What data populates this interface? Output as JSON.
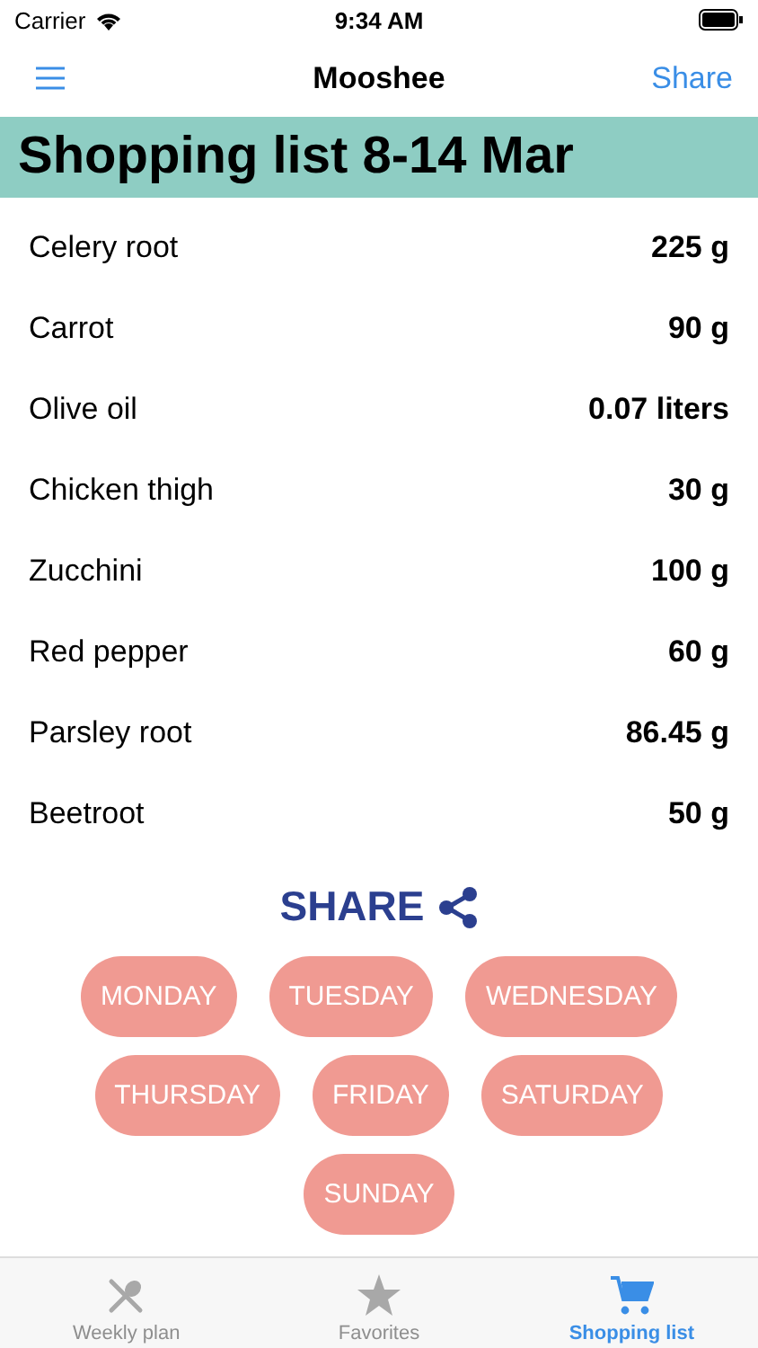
{
  "status_bar": {
    "carrier": "Carrier",
    "time": "9:34 AM"
  },
  "nav": {
    "title": "Mooshee",
    "action": "Share"
  },
  "header": {
    "title": "Shopping list 8-14 Mar"
  },
  "items": [
    {
      "name": "Celery root",
      "amount": "225 g"
    },
    {
      "name": "Carrot",
      "amount": "90 g"
    },
    {
      "name": "Olive oil",
      "amount": "0.07 liters"
    },
    {
      "name": "Chicken thigh",
      "amount": "30 g"
    },
    {
      "name": "Zucchini",
      "amount": "100 g"
    },
    {
      "name": "Red pepper",
      "amount": "60 g"
    },
    {
      "name": "Parsley root",
      "amount": "86.45 g"
    },
    {
      "name": "Beetroot",
      "amount": "50 g"
    }
  ],
  "share": {
    "label": "SHARE"
  },
  "days": [
    "MONDAY",
    "TUESDAY",
    "WEDNESDAY",
    "THURSDAY",
    "FRIDAY",
    "SATURDAY",
    "SUNDAY"
  ],
  "tabs": [
    {
      "label": "Weekly plan",
      "kind": "utensils",
      "selected": false
    },
    {
      "label": "Favorites",
      "kind": "star",
      "selected": false
    },
    {
      "label": "Shopping list",
      "kind": "cart",
      "selected": true
    }
  ]
}
